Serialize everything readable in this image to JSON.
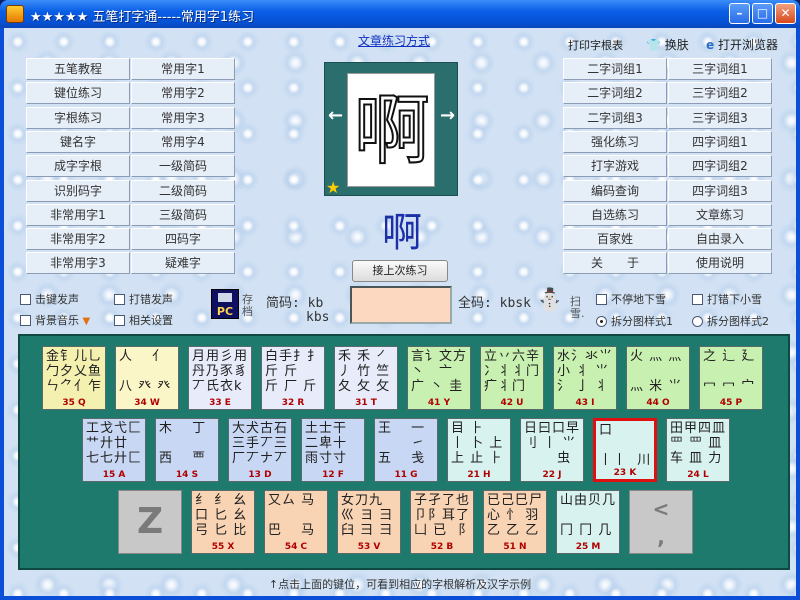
{
  "window": {
    "title": "★★★★★ 五笔打字通-----常用字1练习",
    "minimize_glyph": "–",
    "maximize_glyph": "□",
    "close_glyph": "✕"
  },
  "toplinks": {
    "article_mode": "文章练习方式",
    "print_table": "打印字根表",
    "skin": "换肤",
    "browser": "打开浏览器"
  },
  "left_menu": [
    "五笔教程",
    "常用字1",
    "键位练习",
    "常用字2",
    "字根练习",
    "常用字3",
    "键名字",
    "常用字4",
    "成字字根",
    "一级简码",
    "识别码字",
    "二级简码",
    "非常用字1",
    "三级简码",
    "非常用字2",
    "四码字",
    "非常用字3",
    "疑难字"
  ],
  "right_menu": [
    "二字词组1",
    "三字词组1",
    "二字词组2",
    "三字词组2",
    "二字词组3",
    "三字词组3",
    "强化练习",
    "四字词组1",
    "打字游戏",
    "四字词组2",
    "编码查询",
    "四字词组3",
    "自选练习",
    "文章练习",
    "百家姓",
    "自由录入",
    "关　　于",
    "使用说明"
  ],
  "preview": {
    "char": "啊",
    "left_arrow": "←",
    "right_arrow": "→",
    "star": "★"
  },
  "current": {
    "char": "啊",
    "continue_button": "接上次练习",
    "jianma_label": "简码:",
    "jianma_value1": "kb",
    "jianma_value2": "kbs",
    "quanma_label": "全码:",
    "quanma_value": "kbsk",
    "save_label": "存档",
    "pc_label": "PC",
    "snow_label": "扫雪."
  },
  "options": {
    "key_sound": "击键发声",
    "bg_music": "背景音乐",
    "error_sound": "打错发声",
    "related": "相关设置",
    "no_snow": "不停地下雪",
    "error_snow": "打错下小雪",
    "radical_style1": "拆分图样式1",
    "radical_style2": "拆分图样式2"
  },
  "keyboard": {
    "row1": [
      {
        "roots": "金钅儿乚\n勹夕乂鱼\nㄣ⺈亻乍",
        "label": "35  Q"
      },
      {
        "roots": "人　 亻\n\n八 癶 癶",
        "label": "34  W"
      },
      {
        "roots": "月用彡用\n丹乃豕豸\n丆氏衣k",
        "label": "33  E"
      },
      {
        "roots": "白手扌扌\n斤 斤\n斤 厂 斤",
        "label": "32  R"
      },
      {
        "roots": "禾 禾 ㇒\n丿 竹 竺\n夂 攵 攵",
        "label": "31  T"
      },
      {
        "roots": "言讠文方\n丶　亠\n广 丶 圭",
        "label": "41  Y"
      },
      {
        "roots": "立丷六辛\n冫丬丬门\n疒丬门",
        "label": "42  U"
      },
      {
        "roots": "水⺡氺⺌\n小 丬 ⺌\n氵 亅 丬",
        "label": "43  I"
      },
      {
        "roots": "火 灬 灬\n\n灬 米 ⺌",
        "label": "44  O"
      },
      {
        "roots": "之 辶 廴\n\n冖 冖 宀",
        "label": "45  P"
      }
    ],
    "row2": [
      {
        "roots": "工戈弋匚\n艹廾廿\n七七廾匚",
        "label": "15  A"
      },
      {
        "roots": "木　 丁\n\n西　 覀",
        "label": "14  S"
      },
      {
        "roots": "大犬古石\n三手丆三\n厂丆ナ丆",
        "label": "13  D"
      },
      {
        "roots": "土士干\n二卑十\n雨寸寸",
        "label": "12  F"
      },
      {
        "roots": "王　 一\n　　 ㇀\n五　 戋",
        "label": "11  G"
      },
      {
        "roots": "目 ⺊\n丨 卜 上\n上 止 ⺊",
        "label": "21  H"
      },
      {
        "roots": "日曰口早\n刂 丨 ⺌\n　　 虫",
        "label": "22  J"
      },
      {
        "roots": "口\n\n丨丨  川",
        "label": "23  K"
      },
      {
        "roots": "田甲四皿\n罒 罒 皿\n车 皿 力",
        "label": "24  L"
      }
    ],
    "row3": [
      {
        "roots": "Z",
        "label": ""
      },
      {
        "roots": "纟 纟 幺\n口 匕 幺\n弓 匕 比",
        "label": "55  X"
      },
      {
        "roots": "又ㄙ 马\n\n巴　 马",
        "label": "54  C"
      },
      {
        "roots": "女刀九\n巛 ヨ 彐\n臼 彐 ⺕",
        "label": "53  V"
      },
      {
        "roots": "子孑了也\n卩阝耳了\n凵 已 ⻏",
        "label": "52  B"
      },
      {
        "roots": "已己巳尸\n心 忄 羽\n乙 乙 乙",
        "label": "51  N"
      },
      {
        "roots": "山由贝几\n\n冂 冂 几",
        "label": "25  M"
      },
      {
        "roots": "<\n,",
        "label": ""
      }
    ]
  },
  "footer": "↑点击上面的键位，可看到相应的字根解析及汉字示例"
}
